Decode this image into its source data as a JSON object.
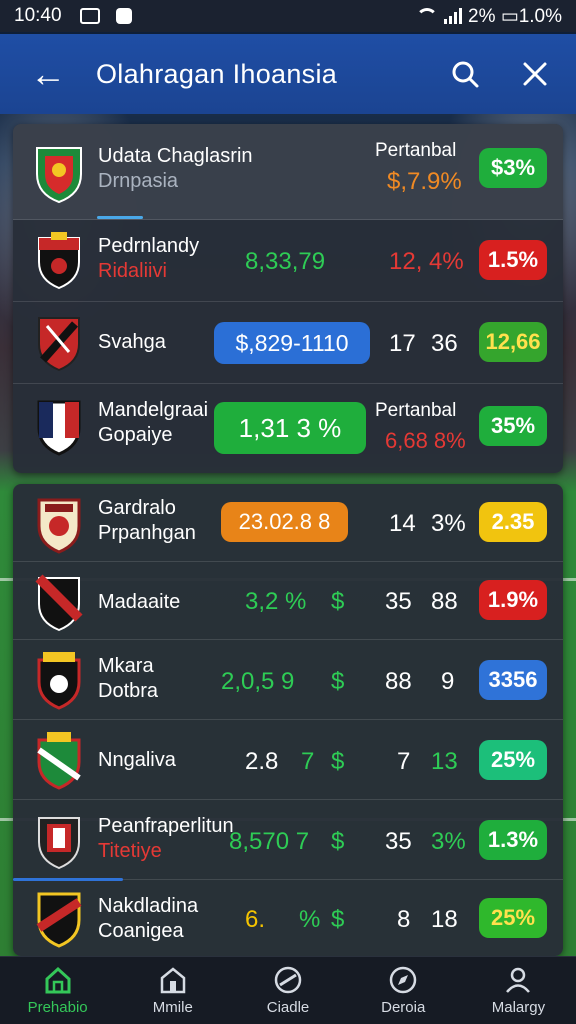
{
  "status_bar": {
    "time": "10:40",
    "battery_text": "2% ▭1.0%"
  },
  "app_bar": {
    "back_glyph": "←",
    "title": "Olahragan Ihoansia"
  },
  "panel_a": {
    "header": {
      "name": "Udata Chaglasrin",
      "sub": "Drnpasia",
      "right_label": "Pertanbal",
      "right_value": "$,7.9%",
      "badge": "$3%"
    },
    "rows": [
      {
        "name": "Pedrnlandy",
        "sub": "Ridaliivi",
        "value": "8,33,79",
        "pct": "12, 4%",
        "badge": "1.5%"
      },
      {
        "name": "Svahga",
        "pill": "$,829-1110",
        "n1": "17",
        "n2": "36",
        "badge": "12,66"
      },
      {
        "name": "Mandelgraai",
        "sub": "Gopaiye",
        "pill": "1,31 3 %",
        "right_label": "Pertanbal",
        "right_value": "6,68 8%",
        "badge": "35%"
      }
    ]
  },
  "panel_b": {
    "rows": [
      {
        "name": "Gardralo",
        "sub": "Prpanhgan",
        "pill": "23.02.8 8",
        "n1": "14",
        "n2": "3%",
        "badge": "2.35"
      },
      {
        "name": "Madaaite",
        "value": "3,2 %",
        "currency": "$",
        "n1": "35",
        "n2": "88",
        "badge": "1.9%"
      },
      {
        "name": "Mkara",
        "sub": "Dotbra",
        "value": "2,0,5 9",
        "currency": "$",
        "n1": "88",
        "n2": "9",
        "badge": "3356"
      },
      {
        "name": "Nngaliva",
        "value": "2.8",
        "value2": "7",
        "currency": "$",
        "n1": "7",
        "n2": "13",
        "badge": "25%"
      },
      {
        "name": "Peanfraperlitun",
        "sub": "Titetiye",
        "value": "8,570 7",
        "currency": "$",
        "n1": "35",
        "n2": "3%",
        "badge": "1.3%"
      },
      {
        "name": "Nakdladina",
        "sub": "Coanigea",
        "value": "6.",
        "value2": "%",
        "currency": "$",
        "n1": "8",
        "n2": "18",
        "badge": "25%"
      }
    ]
  },
  "bottom_nav": [
    {
      "label": "Prehabio",
      "icon": "home-icon",
      "active": true
    },
    {
      "label": "Mmile",
      "icon": "building-icon",
      "active": false
    },
    {
      "label": "Ciadle",
      "icon": "ball-icon",
      "active": false
    },
    {
      "label": "Deroia",
      "icon": "compass-icon",
      "active": false
    },
    {
      "label": "Malargy",
      "icon": "user-icon",
      "active": false
    }
  ],
  "colors": {
    "app_bar": "#1f4ea5",
    "panel": "#282e38",
    "green": "#1fae3c",
    "red": "#d8201f",
    "blue": "#2f73d8",
    "orange": "#e88418",
    "active_nav": "#34c759"
  }
}
